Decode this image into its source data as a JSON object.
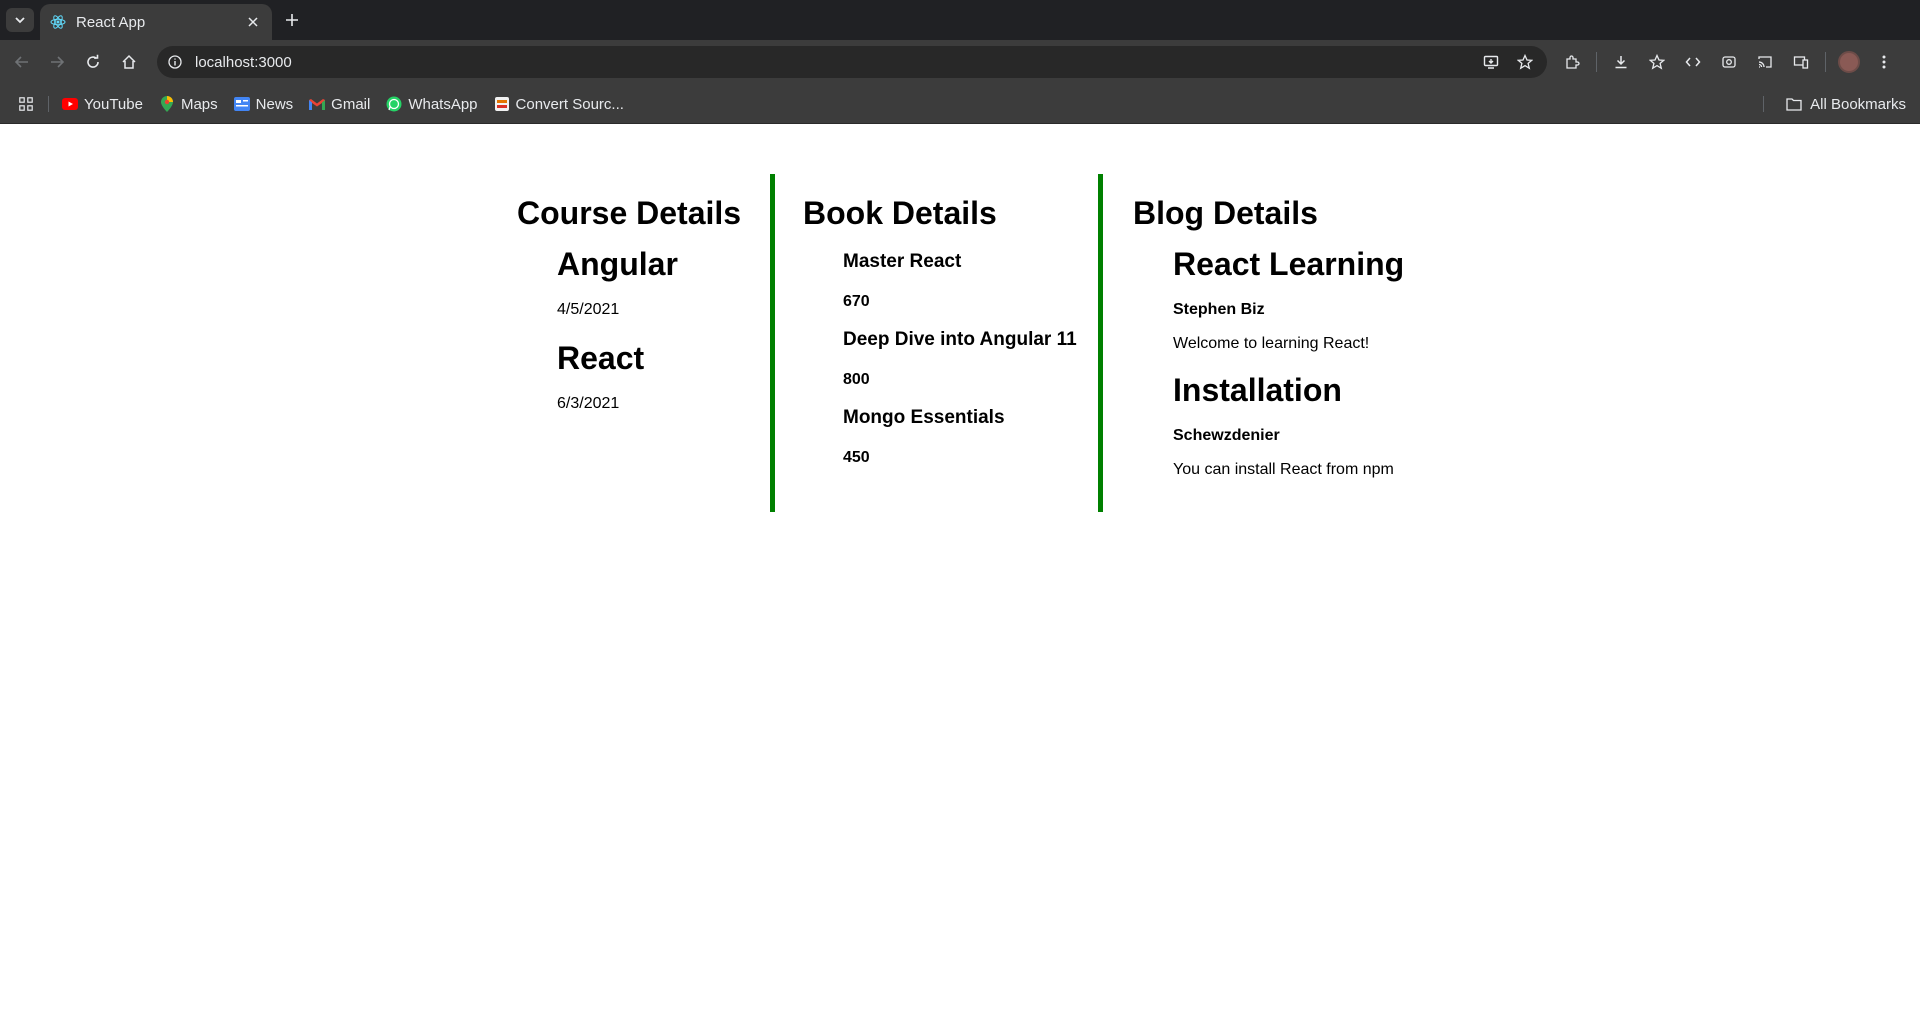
{
  "browser": {
    "tab_title": "React App",
    "url": "localhost:3000",
    "bookmarks": [
      {
        "label": "YouTube",
        "icon": "youtube-icon",
        "color": "#ff0000"
      },
      {
        "label": "Maps",
        "icon": "maps-icon",
        "color": "#34a853"
      },
      {
        "label": "News",
        "icon": "news-icon",
        "color": "#4285f4"
      },
      {
        "label": "Gmail",
        "icon": "gmail-icon",
        "color": "#ea4335"
      },
      {
        "label": "WhatsApp",
        "icon": "whatsapp-icon",
        "color": "#25d366"
      },
      {
        "label": "Convert Sourc...",
        "icon": "convert-icon",
        "color": "#e37400"
      }
    ],
    "all_bookmarks_label": "All Bookmarks"
  },
  "courses": {
    "title": "Course Details",
    "items": [
      {
        "name": "Angular",
        "date": "4/5/2021"
      },
      {
        "name": "React",
        "date": "6/3/2021"
      }
    ]
  },
  "books": {
    "title": "Book Details",
    "items": [
      {
        "name": "Master React",
        "price": "670"
      },
      {
        "name": "Deep Dive into Angular 11",
        "price": "800"
      },
      {
        "name": "Mongo Essentials",
        "price": "450"
      }
    ]
  },
  "blogs": {
    "title": "Blog Details",
    "items": [
      {
        "title": "React Learning",
        "author": "Stephen Biz",
        "content": "Welcome to learning React!"
      },
      {
        "title": "Installation",
        "author": "Schewzdenier",
        "content": "You can install React from npm"
      }
    ]
  },
  "colors": {
    "divider": "#008000",
    "chrome_dark": "#202124",
    "chrome_toolbar": "#3c3c3c"
  }
}
